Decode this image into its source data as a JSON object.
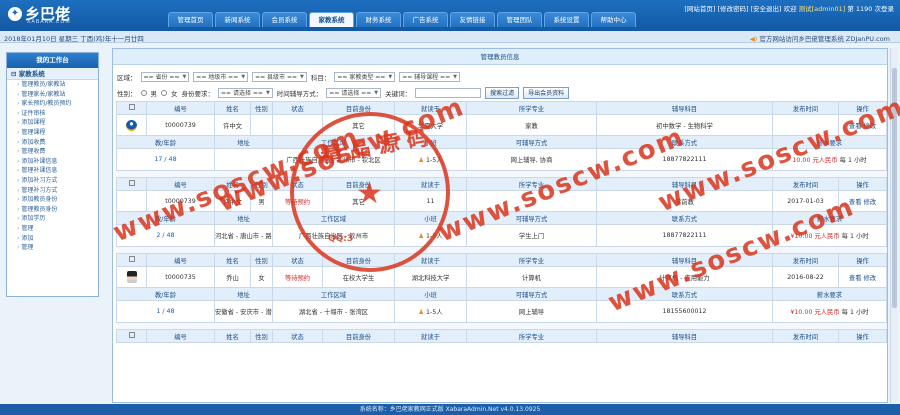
{
  "header": {
    "logo_text": "乡巴佬",
    "logo_sub": "XABARA.COM",
    "nav": [
      "管理首页",
      "新闻系统",
      "会员系统",
      "家教系统",
      "财务系统",
      "广告系统",
      "友情链接",
      "管理团队",
      "系统设置",
      "帮助中心"
    ],
    "active_nav": 3,
    "links": {
      "home": "[网站首页]",
      "change_pwd": "[修改密码]",
      "logout": "[安全退出]",
      "welcome": "欢迎",
      "user": "测试[admin01]",
      "visits": "第 1190 次登录"
    }
  },
  "datebar": {
    "date": "2018年01月10日 星期三 丁酉(鸡)年十一月廿四",
    "notice": "官方网站访问乡巴佬管理系统 ZDJanPU.com"
  },
  "sidebar": {
    "title": "我的工作台",
    "group": "家教系统",
    "items": [
      "管理教员/家教站",
      "管理家长/家教站",
      "家长预约/教员预约",
      "证件审核",
      "添加课程",
      "管理课程",
      "添加收费",
      "管理收费",
      "添加补课信息",
      "管理补课信息",
      "添加补习方式",
      "管理补习方式",
      "添加教员身份",
      "管理教员身份",
      "添加学历",
      "管理",
      "添加",
      "管理"
    ]
  },
  "main": {
    "title": "管理教员信息",
    "filters": {
      "area_label": "区域：",
      "province": "== 省份 ==",
      "city": "== 地级市 ==",
      "county": "== 县级市 ==",
      "subject_label": "科目：",
      "teach_type": "== 家教类型 ==",
      "course": "== 辅导课程 ==",
      "gender_label": "性别：",
      "male": "男",
      "female": "女",
      "identity_label": "身份要求：",
      "identity": "== 请选择 ==",
      "time_label": "时间辅导方式：",
      "time": "== 请选择 ==",
      "keyword_label": "关键词：",
      "search_btn": "搜索过滤",
      "export_btn": "导出会员资料"
    },
    "head1": [
      "编号",
      "姓名",
      "性别",
      "状态",
      "目前身份",
      "就读于",
      "所学专业",
      "辅导科目",
      "发布时间",
      "操作"
    ],
    "head2": [
      "教/年龄",
      "地址",
      "工作区域",
      "小班",
      "可辅导方式",
      "联系方式",
      "薪水要求"
    ],
    "rows": [
      {
        "id": "t0000739",
        "name": "许中文",
        "gender": "",
        "status": "",
        "identity": "其它",
        "school": "华夏大学",
        "major": "家教",
        "subject": "初中数学 - 生物科学",
        "date": "",
        "view": "查看",
        "edit": "修改",
        "age": "17 / 48",
        "address": "",
        "area": "广西壮族自治区 - 钦州市 - 钦北区",
        "small_class": "1-5人",
        "method": "网上辅导, 协商",
        "phone": "18877822111",
        "salary": "10.00 元人民币",
        "unit": "每 1 小时",
        "avatar": "a1"
      },
      {
        "id": "t0000739",
        "name": "许中文",
        "gender": "男",
        "status": "等待预约",
        "identity": "其它",
        "school": "11",
        "major": "",
        "subject": "学前教",
        "date": "2017-01-03",
        "view": "查看",
        "edit": "修改",
        "age": "2 / 48",
        "address": "河北省 - 唐山市 - 路南区 22",
        "area": "广西壮族自治区 - 钦州市",
        "small_class": "1-5人",
        "method": "学生上门",
        "phone": "18877822111",
        "salary": "¥10.00 元人民币",
        "unit": "每 1 小时",
        "avatar": ""
      },
      {
        "id": "t0000735",
        "name": "乔山",
        "gender": "女",
        "status": "等待预约",
        "identity": "在校大学生",
        "school": "湖北科技大学",
        "major": "计算机",
        "subject": "计算机 - 应用能力",
        "date": "2016-08-22",
        "view": "查看",
        "edit": "修改",
        "age": "1 / 48",
        "address": "安徽省 - 安庆市 - 潜山县 潜山县18号",
        "area": "湖北省 - 十堰市 - 张湾区",
        "small_class": "1-5人",
        "method": "网上辅导",
        "phone": "18155600012",
        "salary": "¥10.00 元人民币",
        "unit": "每 1 小时",
        "avatar": "a2"
      }
    ],
    "head_last": [
      "编号",
      "姓名",
      "性别",
      "状态",
      "目前身份",
      "就读于",
      "所学专业",
      "辅导科目",
      "发布时间",
      "操作"
    ]
  },
  "watermark": {
    "text": "www.soscw.com",
    "seal_top": "精品源码",
    "seal_bottom": "QQ:3"
  },
  "footer": {
    "text": "系统名称：乡巴佬家教网正式版 XabaraAdmin.Net v4.0.13.0925"
  }
}
